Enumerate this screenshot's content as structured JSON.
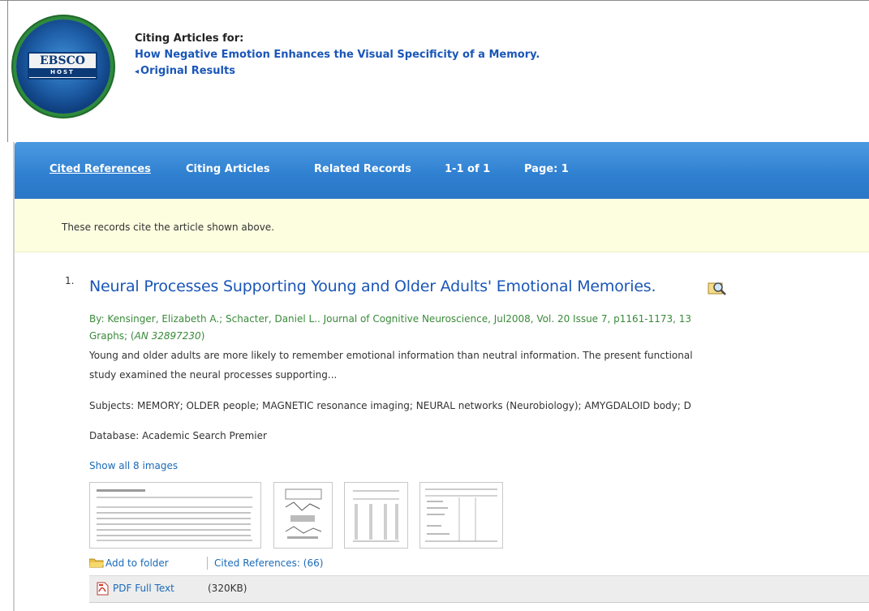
{
  "header": {
    "logo_text": "EBSCO",
    "logo_subtext": "HOST",
    "label": "Citing Articles for:",
    "article_title": "How Negative Emotion Enhances the Visual Specificity of a Memory.",
    "back_link": "Original Results"
  },
  "navbar": {
    "items": [
      "Cited References",
      "Citing Articles",
      "Related Records",
      "1-1 of 1",
      "Page: 1"
    ],
    "active": "Cited References"
  },
  "notice": "These records cite the article shown above.",
  "record": {
    "number": "1.",
    "title": "Neural Processes Supporting Young and Older Adults' Emotional Memories.",
    "byline_1": "By: Kensinger, Elizabeth A.; Schacter, Daniel L.. Journal of Cognitive Neuroscience, Jul2008, Vol. 20 Issue 7, p1161-1173, 13",
    "byline_2_prefix": "Graphs; (",
    "an": "AN 32897230",
    "byline_2_suffix": ")",
    "abstract_1": "Young and older adults are more likely to remember emotional information than neutral information. The present functional",
    "abstract_2": "study examined the neural processes supporting...",
    "subjects": "Subjects: MEMORY; OLDER people; MAGNETIC resonance imaging; NEURAL networks (Neurobiology); AMYGDALOID body; D",
    "database": "Database: Academic Search Premier",
    "show_images": "Show all 8 images",
    "add_to_folder": "Add to folder",
    "cited_references": "Cited References: (66)",
    "pdf_link": "PDF Full Text",
    "pdf_size": "(320KB)"
  },
  "colors": {
    "navbar": "#2f7fd0",
    "link": "#1a56b8",
    "byline_green": "#3a8a3a",
    "notice_bg": "#fdfde0"
  },
  "icons": [
    "ebsco-logo",
    "back-arrow-icon",
    "magnifier-preview-icon",
    "folder-icon",
    "pdf-icon"
  ]
}
